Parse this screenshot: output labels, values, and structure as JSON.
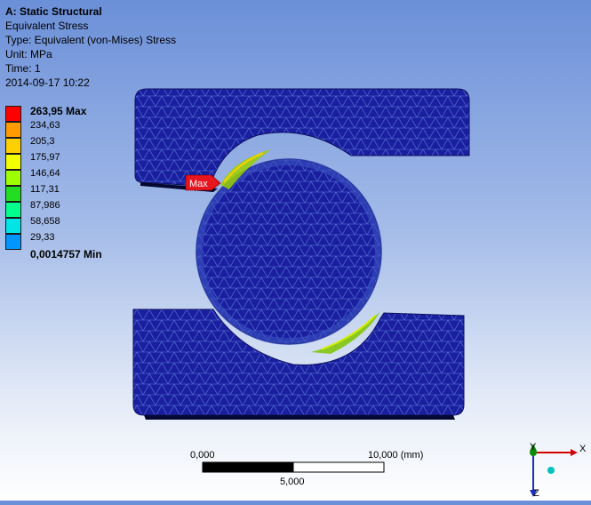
{
  "analysis": {
    "title": "A: Static Structural",
    "result": "Equivalent Stress",
    "type": "Type: Equivalent (von-Mises) Stress",
    "unit": "Unit: MPa",
    "time": "Time: 1",
    "date": "2014-09-17 10:22"
  },
  "legend": {
    "entries": [
      {
        "label": "263,95 Max",
        "color": "#ff0000"
      },
      {
        "label": "234,63",
        "color": "#ff9a00"
      },
      {
        "label": "205,3",
        "color": "#ffd000"
      },
      {
        "label": "175,97",
        "color": "#f2ff00"
      },
      {
        "label": "146,64",
        "color": "#9eff00"
      },
      {
        "label": "117,31",
        "color": "#22dd22"
      },
      {
        "label": "87,986",
        "color": "#00ff8c"
      },
      {
        "label": "58,658",
        "color": "#00e6e6"
      },
      {
        "label": "29,33",
        "color": "#0095ff"
      },
      {
        "label": "0,0014757 Min",
        "color": "#0000ff"
      }
    ]
  },
  "probe": {
    "max_label": "Max"
  },
  "scale": {
    "left": "0,000",
    "right": "10,000 (mm)",
    "middle": "5,000"
  },
  "triad": {
    "x": "X",
    "y": "Y",
    "z": "Z"
  },
  "colors": {
    "mesh_fill": "#1a1fa0",
    "mesh_lines": "#5c78d8",
    "background_top": "#6b8fd8"
  }
}
